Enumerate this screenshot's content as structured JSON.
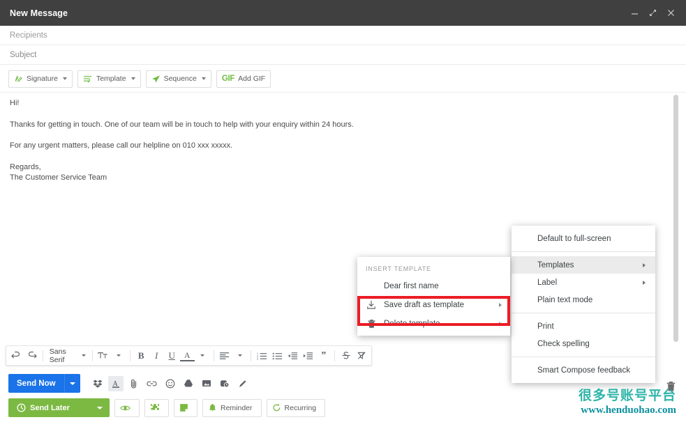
{
  "window": {
    "title": "New Message",
    "controls": [
      {
        "name": "minimize",
        "glyph": "—"
      },
      {
        "name": "expand",
        "glyph": "⤢"
      },
      {
        "name": "close",
        "glyph": "✕"
      }
    ]
  },
  "compose": {
    "recipients_placeholder": "Recipients",
    "subject_placeholder": "Subject",
    "body": {
      "greeting": "Hi!",
      "paragraph1": "Thanks for getting in touch. One of our team will be in touch to help with your enquiry within 24 hours.",
      "paragraph2": "For any urgent matters, please call our helpline on 010 xxx xxxxx.",
      "signoff": "Regards,",
      "signature": "The Customer Service Team"
    }
  },
  "plugin_toolbar": {
    "buttons": [
      {
        "label": "Signature",
        "icon": "signature-icon",
        "caret": true
      },
      {
        "label": "Template",
        "icon": "template-icon",
        "caret": true
      },
      {
        "label": "Sequence",
        "icon": "sequence-icon",
        "caret": true
      },
      {
        "label": "Add GIF",
        "icon": "gif-icon",
        "caret": false,
        "icon_text": "GIF"
      }
    ]
  },
  "format_toolbar": {
    "font_name": "Sans Serif",
    "items": [
      {
        "name": "undo-icon"
      },
      {
        "name": "redo-icon"
      },
      {
        "name": "font-family-select"
      },
      {
        "name": "font-size-icon"
      },
      {
        "name": "bold-icon",
        "glyph": "B"
      },
      {
        "name": "italic-icon",
        "glyph": "I"
      },
      {
        "name": "underline-icon",
        "glyph": "U"
      },
      {
        "name": "text-color-icon",
        "glyph": "A"
      },
      {
        "name": "align-icon"
      },
      {
        "name": "numbered-list-icon"
      },
      {
        "name": "bulleted-list-icon"
      },
      {
        "name": "indent-less-icon"
      },
      {
        "name": "indent-more-icon"
      },
      {
        "name": "quote-icon",
        "glyph": "”"
      },
      {
        "name": "strikethrough-icon"
      },
      {
        "name": "remove-formatting-icon"
      }
    ]
  },
  "send_row": {
    "send_now_label": "Send Now",
    "icons": [
      {
        "name": "dropbox-icon"
      },
      {
        "name": "formatting-options-icon"
      },
      {
        "name": "attach-file-icon"
      },
      {
        "name": "insert-link-icon"
      },
      {
        "name": "insert-emoji-icon"
      },
      {
        "name": "insert-drive-icon"
      },
      {
        "name": "insert-photo-icon"
      },
      {
        "name": "confidential-mode-icon"
      },
      {
        "name": "insert-signature-icon"
      }
    ]
  },
  "schedule_row": {
    "send_later_label": "Send Later",
    "buttons": [
      {
        "label": "",
        "icon": "tracking-eye-icon",
        "caret": true
      },
      {
        "label": "",
        "icon": "puzzle-icon",
        "caret": true
      },
      {
        "label": "",
        "icon": "notes-icon",
        "caret": true
      },
      {
        "label": "Reminder",
        "icon": "bell-icon",
        "caret": true
      },
      {
        "label": "Recurring",
        "icon": "recurring-icon",
        "caret": true
      }
    ]
  },
  "trash": {
    "name": "discard-draft-icon"
  },
  "context_menu": {
    "items": [
      {
        "label": "Default to full-screen",
        "submenu": false,
        "highlighted": false
      },
      {
        "separator": true
      },
      {
        "label": "Templates",
        "submenu": true,
        "highlighted": true
      },
      {
        "label": "Label",
        "submenu": true,
        "highlighted": false
      },
      {
        "label": "Plain text mode",
        "submenu": false,
        "highlighted": false
      },
      {
        "separator": true
      },
      {
        "label": "Print",
        "submenu": false,
        "highlighted": false
      },
      {
        "label": "Check spelling",
        "submenu": false,
        "highlighted": false
      },
      {
        "separator": true
      },
      {
        "label": "Smart Compose feedback",
        "submenu": false,
        "highlighted": false
      }
    ]
  },
  "template_submenu": {
    "header": "INSERT TEMPLATE",
    "items": [
      {
        "label": "Dear first name",
        "icon": null,
        "submenu": false
      },
      {
        "label": "Save draft as template",
        "icon": "save-download-icon",
        "submenu": true
      },
      {
        "label": "Delete template",
        "icon": "trash-icon",
        "submenu": true
      }
    ],
    "highlight_color": "#ec1c24",
    "highlighted_item": "Save draft as template"
  },
  "watermark": {
    "cn_text": "很多号账号平台",
    "url_text": "www.henduohao.com",
    "color": "#2fb5a8"
  },
  "colors": {
    "titlebar": "#404040",
    "send_now": "#1a73e8",
    "send_later": "#7cb943",
    "accent_green": "#6fbd44",
    "highlight_red": "#ec1c24"
  }
}
